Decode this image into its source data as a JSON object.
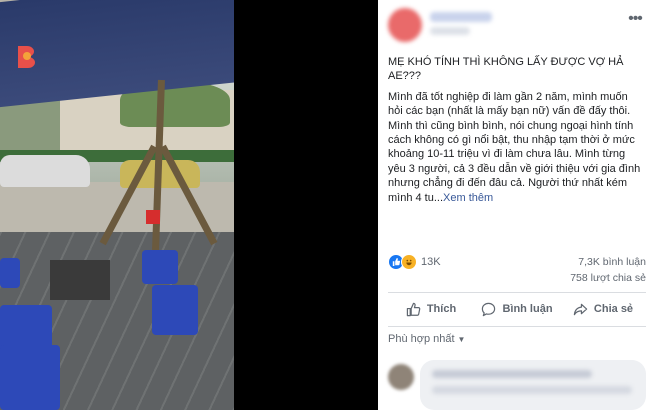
{
  "post": {
    "title": "MẸ KHÓ TÍNH THÌ KHÔNG LẤY ĐƯỢC VỢ HẢ AE???",
    "body": "Mình đã tốt nghiệp đi làm gần 2 năm, mình muốn hỏi các bạn (nhất là mấy bạn nữ) vấn đề đấy thôi. Mình thì cũng bình bình, nói chung ngoại hình tính cách không có gì nổi bật, thu nhập tạm thời ở mức khoảng 10-11 triệu vì đi làm chưa lâu. Mình từng yêu 3 người, cả 3 đều dẫn về giới thiệu với gia đình nhưng chẳng đi đến đâu cả. Người thứ nhất kém mình 4 tu...",
    "see_more": "Xem thêm"
  },
  "stats": {
    "reactions_count": "13K",
    "comments": "7,3K bình luận",
    "shares": "758 lượt chia sẻ"
  },
  "actions": {
    "like": "Thích",
    "comment": "Bình luận",
    "share": "Chia sẻ"
  },
  "comments_sort": {
    "label": "Phù hợp nhất"
  },
  "colors": {
    "link": "#385898",
    "like_blue": "#1877f2",
    "muted_text": "#606770"
  },
  "icons": {
    "more": "more-options-icon",
    "like": "thumbs-up-icon",
    "comment": "comment-bubble-icon",
    "share": "share-arrow-icon"
  }
}
